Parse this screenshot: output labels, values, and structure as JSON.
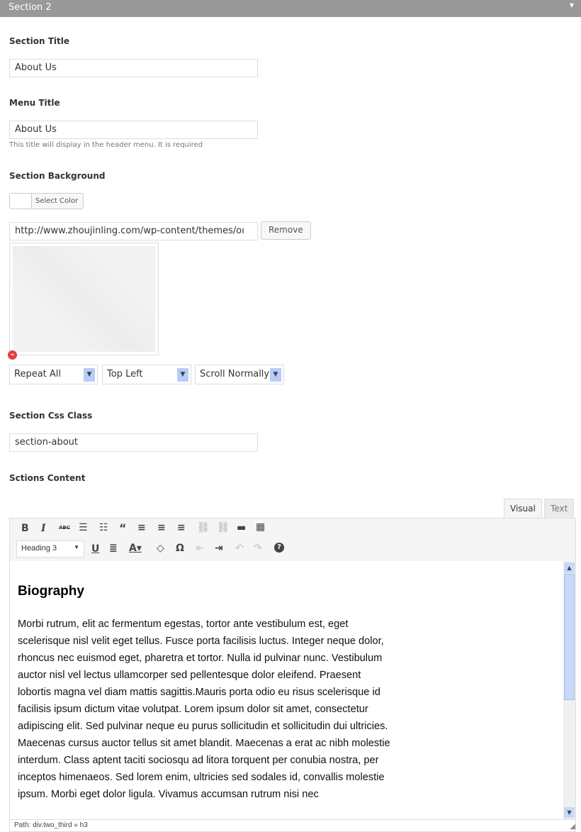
{
  "section": {
    "title": "Section 2"
  },
  "fields": {
    "section_title": {
      "label": "Section Title",
      "value": "About Us"
    },
    "menu_title": {
      "label": "Menu Title",
      "value": "About Us",
      "hint": "This title will display in the header menu. It is required"
    },
    "background": {
      "label": "Section Background",
      "select_color": "Select Color",
      "url": "http://www.zhoujinling.com/wp-content/themes/oı",
      "remove": "Remove",
      "repeat": "Repeat All",
      "position": "Top Left",
      "attachment": "Scroll Normally"
    },
    "css_class": {
      "label": "Section Css Class",
      "value": "section-about"
    },
    "content": {
      "label": "Sctions Content"
    }
  },
  "editor": {
    "tabs": [
      "Visual",
      "Text"
    ],
    "format": "Heading 3",
    "heading": "Biography",
    "body": "Morbi rutrum, elit ac fermentum egestas, tortor ante vestibulum est, eget scelerisque nisl velit eget tellus. Fusce porta facilisis luctus. Integer neque dolor, rhoncus nec euismod eget, pharetra et tortor. Nulla id pulvinar nunc. Vestibulum auctor nisl vel lectus ullamcorper sed pellentesque dolor eleifend. Praesent lobortis magna vel diam mattis sagittis.Mauris porta odio eu risus scelerisque id facilisis ipsum dictum vitae volutpat. Lorem ipsum dolor sit amet, consectetur adipiscing elit. Sed pulvinar neque eu purus sollicitudin et sollicitudin dui ultricies. Maecenas cursus auctor tellus sit amet blandit. Maecenas a erat ac nibh molestie interdum. Class aptent taciti sociosqu ad litora torquent per conubia nostra, per inceptos himenaeos. Sed lorem enim, ultricies sed sodales id, convallis molestie ipsum. Morbi eget dolor ligula. Vivamus accumsan rutrum nisi nec",
    "path": "Path: div.two_third » h3"
  }
}
